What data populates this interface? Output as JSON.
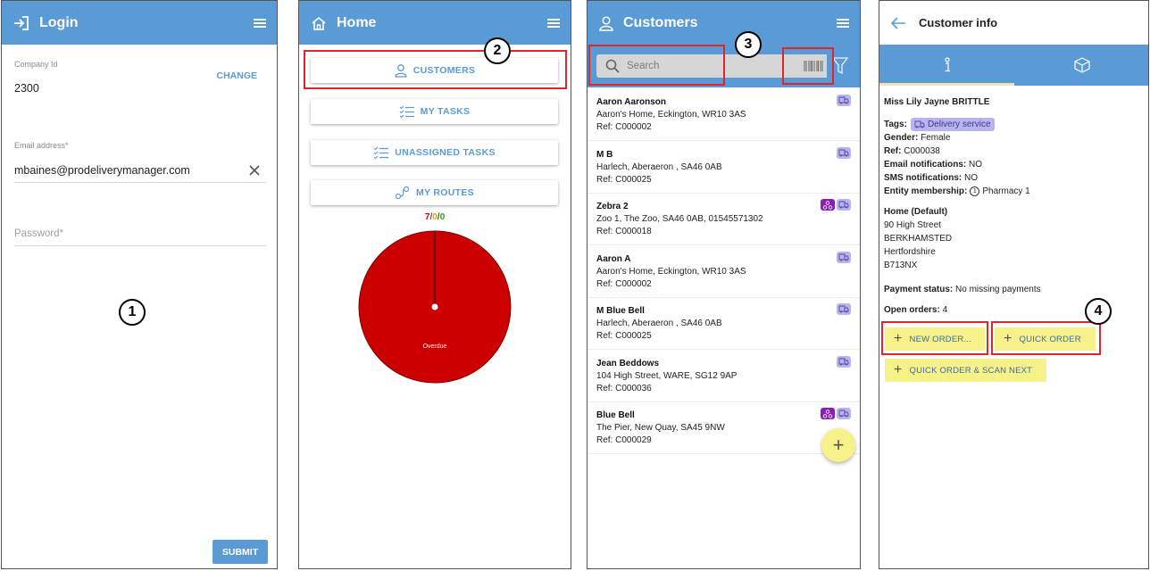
{
  "login": {
    "title": "Login",
    "company_label": "Company Id",
    "company_value": "2300",
    "change_label": "CHANGE",
    "email_label": "Email address*",
    "email_value": "mbaines@prodeliverymanager.com",
    "password_placeholder": "Password*",
    "submit_label": "SUBMIT",
    "callout": "1"
  },
  "home": {
    "title": "Home",
    "menu": [
      "CUSTOMERS",
      "MY TASKS",
      "UNASSIGNED TASKS",
      "MY ROUTES"
    ],
    "stats": {
      "a": "7",
      "b": "0",
      "c": "0"
    },
    "pie_label": "Overdue",
    "callout": "2"
  },
  "customers": {
    "title": "Customers",
    "search_placeholder": "Search",
    "callout": "3",
    "items": [
      {
        "name": "Aaron Aaronson",
        "address": "Aaron's Home, Eckington, WR10 3AS",
        "ref": "Ref: C000002",
        "extra": false
      },
      {
        "name": "M B",
        "address": "Harlech, Aberaeron , SA46 0AB",
        "ref": "Ref: C000025",
        "extra": false
      },
      {
        "name": "Zebra 2",
        "address": "Zoo 1, The Zoo, SA46 0AB, 01545571302",
        "ref": "Ref: C000018",
        "extra": true
      },
      {
        "name": "Aaron A",
        "address": "Aaron's Home, Eckington, WR10 3AS",
        "ref": "Ref: C000002",
        "extra": false
      },
      {
        "name": "M Blue Bell",
        "address": "Harlech, Aberaeron , SA46 0AB",
        "ref": "Ref: C000025",
        "extra": false
      },
      {
        "name": "Jean Beddows",
        "address": "104 High Street, WARE, SG12 9AP",
        "ref": "Ref: C000036",
        "extra": false
      },
      {
        "name": "Blue Bell",
        "address": "The Pier, New Quay, SA45 9NW",
        "ref": "Ref: C000029",
        "extra": true
      }
    ],
    "fab_label": "+"
  },
  "info": {
    "title": "Customer info",
    "name": "Miss Lily Jayne BRITTLE",
    "tags_label": "Tags:",
    "tag": "Delivery service",
    "gender_label": "Gender:",
    "gender": "Female",
    "ref_label": "Ref:",
    "ref": "C000038",
    "email_notif_label": "Email notifications:",
    "email_notif": "NO",
    "sms_notif_label": "SMS notifications:",
    "sms_notif": "NO",
    "entity_label": "Entity membership:",
    "entity_num": "1",
    "entity": "Pharmacy 1",
    "address_title": "Home (Default)",
    "address_lines": [
      "90 High Street",
      "BERKHAMSTED",
      "Hertfordshire",
      "B713NX"
    ],
    "payment_label": "Payment status:",
    "payment": "No missing payments",
    "open_orders_label": "Open orders:",
    "open_orders": "4",
    "new_order_label": "NEW ORDER...",
    "quick_order_label": "QUICK ORDER",
    "quick_scan_label": "QUICK ORDER & SCAN NEXT",
    "callout": "4"
  },
  "colors": {
    "appbar": "#5b9bd5",
    "highlight": "#e0262d",
    "pie": "#cc0000",
    "badge_truck": "#b9b4ef",
    "badge_extra": "#8a1fb8",
    "button_yellow": "#f7f18a"
  }
}
